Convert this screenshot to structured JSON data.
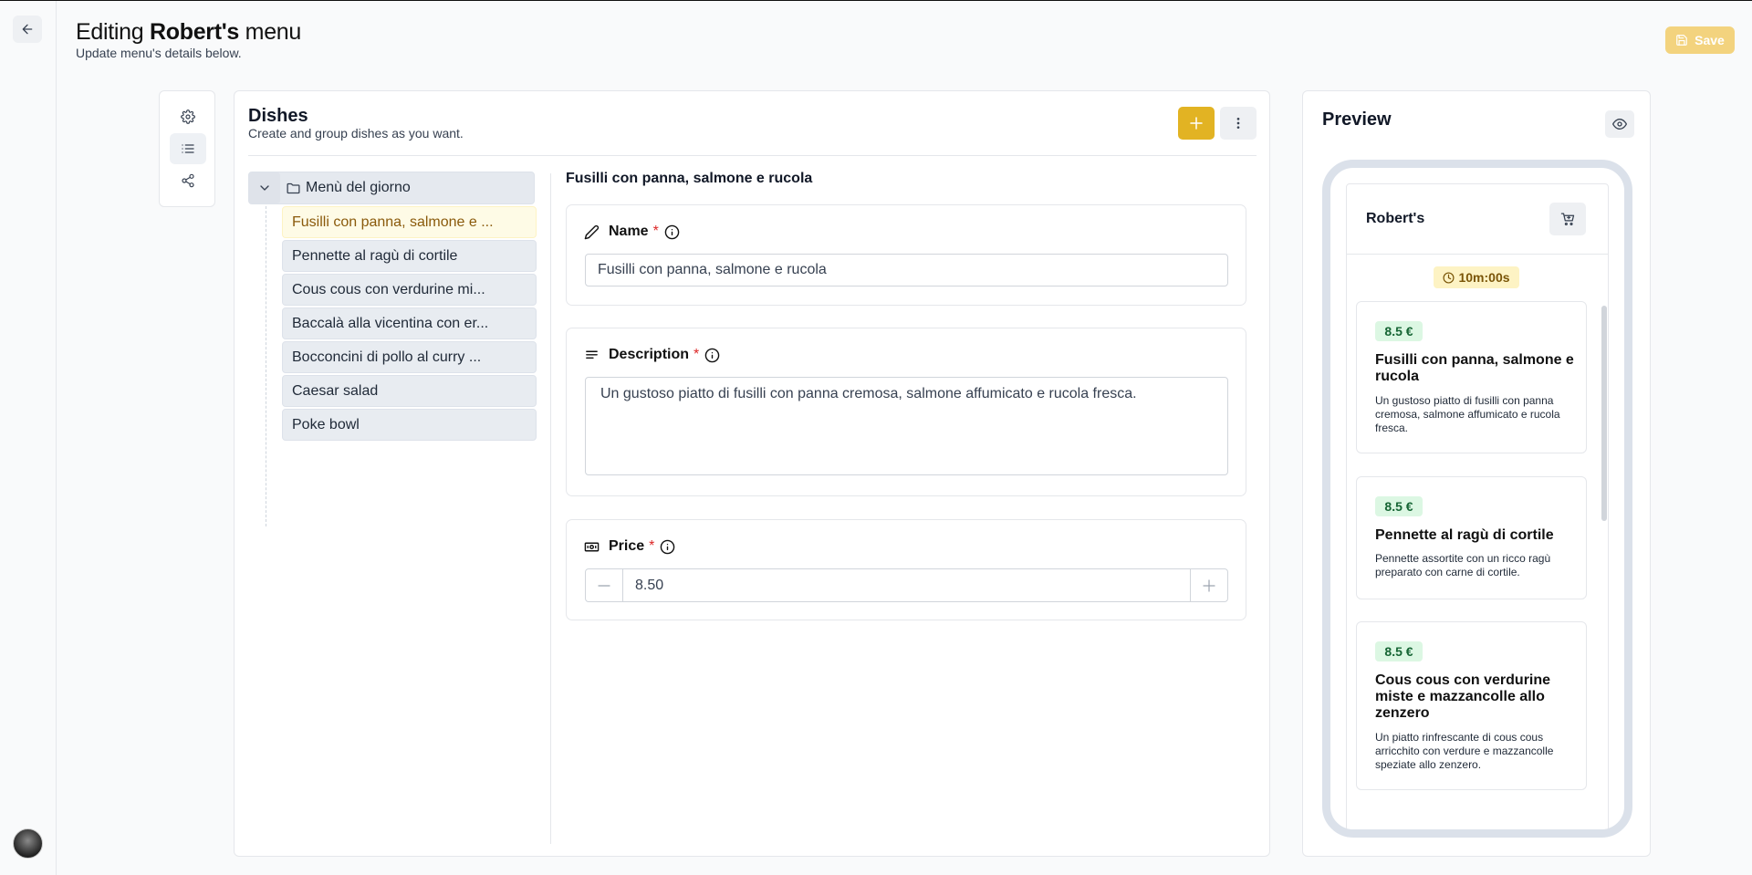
{
  "header": {
    "title_prefix": "Editing",
    "title_name": "Robert's",
    "title_suffix": "menu",
    "subtitle": "Update menu's details below.",
    "save_label": "Save"
  },
  "dishes_panel": {
    "title": "Dishes",
    "subtitle": "Create and group dishes as you want.",
    "group": {
      "label": "Menù del giorno"
    },
    "items": [
      {
        "label": "Fusilli con panna, salmone e ...",
        "selected": true
      },
      {
        "label": "Pennette al ragù di cortile"
      },
      {
        "label": "Cous cous con verdurine mi..."
      },
      {
        "label": "Baccalà alla vicentina con er..."
      },
      {
        "label": "Bocconcini di pollo al curry ..."
      },
      {
        "label": "Caesar salad"
      },
      {
        "label": "Poke bowl"
      }
    ]
  },
  "editor": {
    "heading": "Fusilli con panna, salmone e rucola",
    "name_label": "Name",
    "name_value": "Fusilli con panna, salmone e rucola",
    "description_label": "Description",
    "description_value": "Un gustoso piatto di fusilli con panna cremosa, salmone affumicato e rucola fresca.",
    "price_label": "Price",
    "price_value": "8.50",
    "required_mark": "*"
  },
  "preview": {
    "title": "Preview",
    "restaurant_name": "Robert's",
    "timer": "10m:00s",
    "cards": [
      {
        "price": "8.5 €",
        "title": "Fusilli con panna, salmone e rucola",
        "description": "Un gustoso piatto di fusilli con panna cremosa, salmone affumicato e rucola fresca."
      },
      {
        "price": "8.5 €",
        "title": "Pennette al ragù di cortile",
        "description": "Pennette assortite con un ricco ragù preparato con carne di cortile."
      },
      {
        "price": "8.5 €",
        "title": "Cous cous con verdurine miste e mazzancolle allo zenzero",
        "description": "Un piatto rinfrescante di cous cous arricchito con verdure e mazzancolle speziate allo zenzero."
      }
    ]
  },
  "icons": {
    "back": "arrow-left-icon",
    "settings": "gear-icon",
    "list": "list-icon",
    "share": "share-icon",
    "add": "plus-icon",
    "more": "more-vertical-icon",
    "folder": "folder-icon",
    "chevron": "chevron-down-icon",
    "edit": "pencil-icon",
    "text": "align-left-icon",
    "price": "banknote-icon",
    "info": "info-icon",
    "eye": "eye-icon",
    "cart": "cart-icon",
    "clock": "clock-icon",
    "save": "save-icon"
  },
  "colors": {
    "accent": "#e2b323",
    "save_disabled": "#f3d37e",
    "selected_bg": "#fefbe6",
    "price_badge_bg": "#dcf7e3",
    "timer_bg": "#fdf3c4",
    "required": "#dc2626"
  }
}
